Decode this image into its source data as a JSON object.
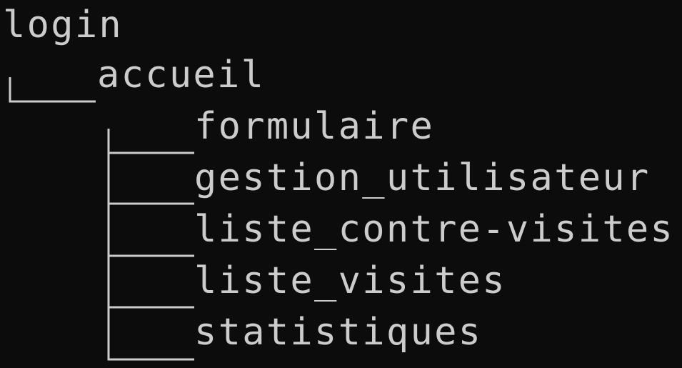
{
  "terminal": {
    "background": "#0c0c0c",
    "foreground": "#cccccc",
    "root": "login",
    "child": "accueil",
    "grandchildren": [
      "formulaire",
      "gestion_utilisateur",
      "liste_contre-visites",
      "liste_visites",
      "statistiques"
    ],
    "last_branch_icon": "tree-corner-icon",
    "branch_icon": "tree-tee-icon",
    "connector_icon": "tree-vertical-line-icon"
  }
}
